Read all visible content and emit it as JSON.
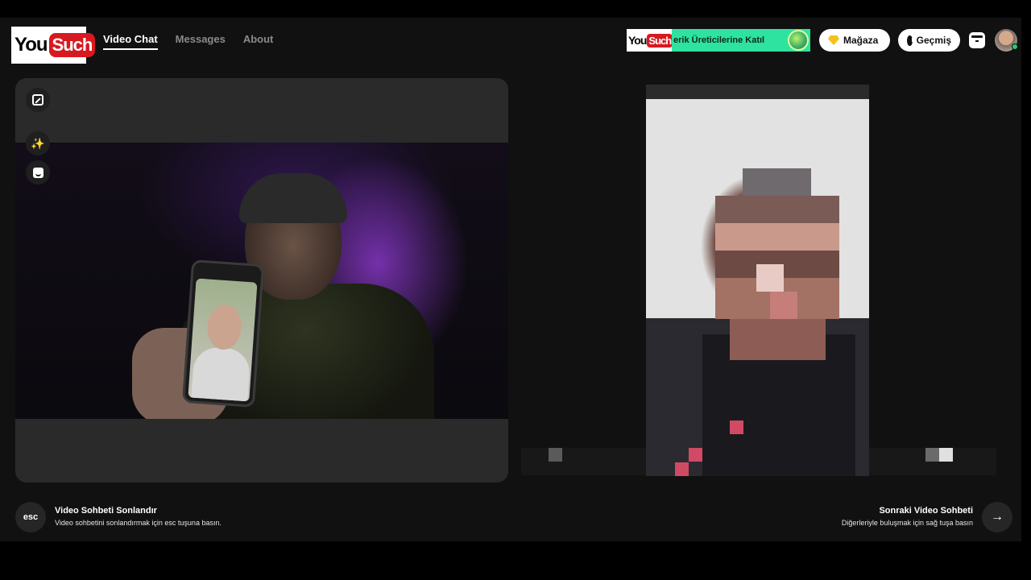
{
  "header": {
    "logo": {
      "part1": "You",
      "part2": "Such"
    },
    "nav": [
      {
        "label": "Video Chat",
        "active": true
      },
      {
        "label": "Messages",
        "active": false
      },
      {
        "label": "About",
        "active": false
      }
    ],
    "promo": {
      "logo_part1": "You",
      "logo_part2": "Such",
      "text": "erik Üreticilerine Katıl"
    },
    "store_label": "Mağaza",
    "history_label": "Geçmiş"
  },
  "icons": {
    "store": "gem-icon",
    "history": "clock-icon",
    "inbox": "inbox-icon",
    "expand": "expand-icon",
    "effects": "magic-wand-icon",
    "masks": "face-icon",
    "next": "arrow-right-icon"
  },
  "controls": {
    "wand_glyph": "✨",
    "next_glyph": "→"
  },
  "footer": {
    "esc_key": "esc",
    "end_title": "Video Sohbeti Sonlandır",
    "end_sub": "Video sohbetini sonlandırmak için esc tuşuna basın.",
    "next_title": "Sonraki Video Sohbeti",
    "next_sub": "Diğerleriyle buluşmak için sağ tuşa basın"
  },
  "colors": {
    "background": "#111111",
    "panel": "#2a2a2a",
    "promo_green": "#2ee3a0",
    "brand_red": "#d71920",
    "online": "#2ecc71"
  }
}
